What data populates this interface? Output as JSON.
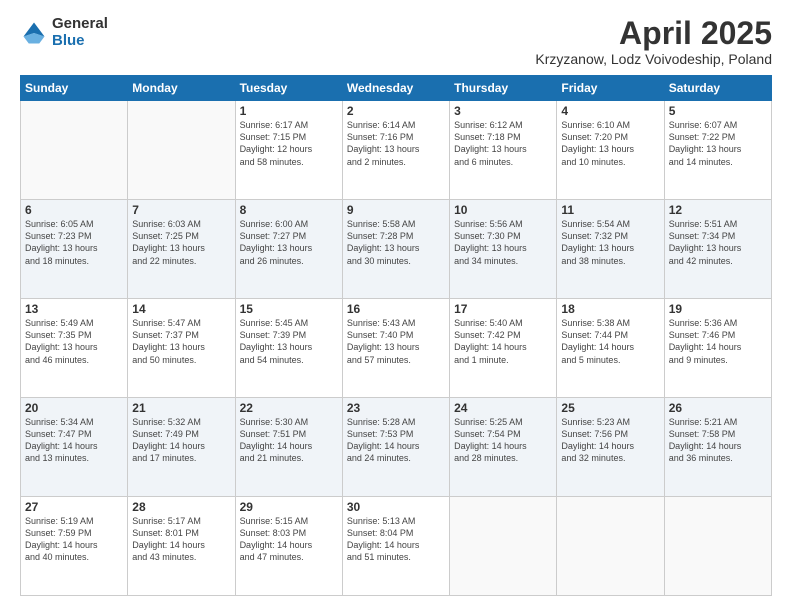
{
  "logo": {
    "general": "General",
    "blue": "Blue"
  },
  "title": "April 2025",
  "location": "Krzyzanow, Lodz Voivodeship, Poland",
  "days_header": [
    "Sunday",
    "Monday",
    "Tuesday",
    "Wednesday",
    "Thursday",
    "Friday",
    "Saturday"
  ],
  "weeks": [
    {
      "days": [
        {
          "num": "",
          "info": ""
        },
        {
          "num": "",
          "info": ""
        },
        {
          "num": "1",
          "info": "Sunrise: 6:17 AM\nSunset: 7:15 PM\nDaylight: 12 hours\nand 58 minutes."
        },
        {
          "num": "2",
          "info": "Sunrise: 6:14 AM\nSunset: 7:16 PM\nDaylight: 13 hours\nand 2 minutes."
        },
        {
          "num": "3",
          "info": "Sunrise: 6:12 AM\nSunset: 7:18 PM\nDaylight: 13 hours\nand 6 minutes."
        },
        {
          "num": "4",
          "info": "Sunrise: 6:10 AM\nSunset: 7:20 PM\nDaylight: 13 hours\nand 10 minutes."
        },
        {
          "num": "5",
          "info": "Sunrise: 6:07 AM\nSunset: 7:22 PM\nDaylight: 13 hours\nand 14 minutes."
        }
      ]
    },
    {
      "days": [
        {
          "num": "6",
          "info": "Sunrise: 6:05 AM\nSunset: 7:23 PM\nDaylight: 13 hours\nand 18 minutes."
        },
        {
          "num": "7",
          "info": "Sunrise: 6:03 AM\nSunset: 7:25 PM\nDaylight: 13 hours\nand 22 minutes."
        },
        {
          "num": "8",
          "info": "Sunrise: 6:00 AM\nSunset: 7:27 PM\nDaylight: 13 hours\nand 26 minutes."
        },
        {
          "num": "9",
          "info": "Sunrise: 5:58 AM\nSunset: 7:28 PM\nDaylight: 13 hours\nand 30 minutes."
        },
        {
          "num": "10",
          "info": "Sunrise: 5:56 AM\nSunset: 7:30 PM\nDaylight: 13 hours\nand 34 minutes."
        },
        {
          "num": "11",
          "info": "Sunrise: 5:54 AM\nSunset: 7:32 PM\nDaylight: 13 hours\nand 38 minutes."
        },
        {
          "num": "12",
          "info": "Sunrise: 5:51 AM\nSunset: 7:34 PM\nDaylight: 13 hours\nand 42 minutes."
        }
      ]
    },
    {
      "days": [
        {
          "num": "13",
          "info": "Sunrise: 5:49 AM\nSunset: 7:35 PM\nDaylight: 13 hours\nand 46 minutes."
        },
        {
          "num": "14",
          "info": "Sunrise: 5:47 AM\nSunset: 7:37 PM\nDaylight: 13 hours\nand 50 minutes."
        },
        {
          "num": "15",
          "info": "Sunrise: 5:45 AM\nSunset: 7:39 PM\nDaylight: 13 hours\nand 54 minutes."
        },
        {
          "num": "16",
          "info": "Sunrise: 5:43 AM\nSunset: 7:40 PM\nDaylight: 13 hours\nand 57 minutes."
        },
        {
          "num": "17",
          "info": "Sunrise: 5:40 AM\nSunset: 7:42 PM\nDaylight: 14 hours\nand 1 minute."
        },
        {
          "num": "18",
          "info": "Sunrise: 5:38 AM\nSunset: 7:44 PM\nDaylight: 14 hours\nand 5 minutes."
        },
        {
          "num": "19",
          "info": "Sunrise: 5:36 AM\nSunset: 7:46 PM\nDaylight: 14 hours\nand 9 minutes."
        }
      ]
    },
    {
      "days": [
        {
          "num": "20",
          "info": "Sunrise: 5:34 AM\nSunset: 7:47 PM\nDaylight: 14 hours\nand 13 minutes."
        },
        {
          "num": "21",
          "info": "Sunrise: 5:32 AM\nSunset: 7:49 PM\nDaylight: 14 hours\nand 17 minutes."
        },
        {
          "num": "22",
          "info": "Sunrise: 5:30 AM\nSunset: 7:51 PM\nDaylight: 14 hours\nand 21 minutes."
        },
        {
          "num": "23",
          "info": "Sunrise: 5:28 AM\nSunset: 7:53 PM\nDaylight: 14 hours\nand 24 minutes."
        },
        {
          "num": "24",
          "info": "Sunrise: 5:25 AM\nSunset: 7:54 PM\nDaylight: 14 hours\nand 28 minutes."
        },
        {
          "num": "25",
          "info": "Sunrise: 5:23 AM\nSunset: 7:56 PM\nDaylight: 14 hours\nand 32 minutes."
        },
        {
          "num": "26",
          "info": "Sunrise: 5:21 AM\nSunset: 7:58 PM\nDaylight: 14 hours\nand 36 minutes."
        }
      ]
    },
    {
      "days": [
        {
          "num": "27",
          "info": "Sunrise: 5:19 AM\nSunset: 7:59 PM\nDaylight: 14 hours\nand 40 minutes."
        },
        {
          "num": "28",
          "info": "Sunrise: 5:17 AM\nSunset: 8:01 PM\nDaylight: 14 hours\nand 43 minutes."
        },
        {
          "num": "29",
          "info": "Sunrise: 5:15 AM\nSunset: 8:03 PM\nDaylight: 14 hours\nand 47 minutes."
        },
        {
          "num": "30",
          "info": "Sunrise: 5:13 AM\nSunset: 8:04 PM\nDaylight: 14 hours\nand 51 minutes."
        },
        {
          "num": "",
          "info": ""
        },
        {
          "num": "",
          "info": ""
        },
        {
          "num": "",
          "info": ""
        }
      ]
    }
  ]
}
